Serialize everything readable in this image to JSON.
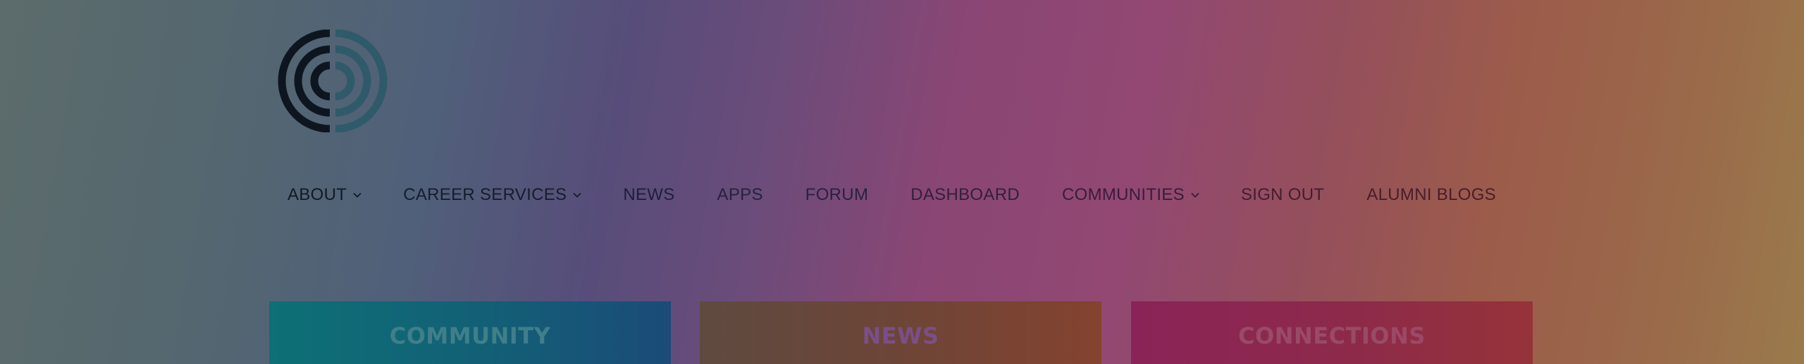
{
  "logo": {
    "icon": "concentric-arcs-logo-icon",
    "colors": {
      "left": "#0d1620",
      "right": "#2f5a6a"
    }
  },
  "nav": {
    "items": [
      {
        "label": "ABOUT",
        "has_dropdown": true,
        "color": "#111a24"
      },
      {
        "label": "CAREER SERVICES",
        "has_dropdown": true,
        "color": "#151d2c"
      },
      {
        "label": "NEWS",
        "has_dropdown": false,
        "color": "#1e1f3a"
      },
      {
        "label": "APPS",
        "has_dropdown": false,
        "color": "#25223e"
      },
      {
        "label": "FORUM",
        "has_dropdown": false,
        "color": "#2a213e"
      },
      {
        "label": "DASHBOARD",
        "has_dropdown": false,
        "color": "#31203e"
      },
      {
        "label": "COMMUNITIES",
        "has_dropdown": true,
        "color": "#3a1c3c"
      },
      {
        "label": "SIGN OUT",
        "has_dropdown": false,
        "color": "#461b30"
      },
      {
        "label": "ALUMNI BLOGS",
        "has_dropdown": false,
        "color": "#4a1d2a"
      }
    ]
  },
  "cards": {
    "community": "COMMUNITY",
    "news": "NEWS",
    "connections": "CONNECTIONS"
  }
}
